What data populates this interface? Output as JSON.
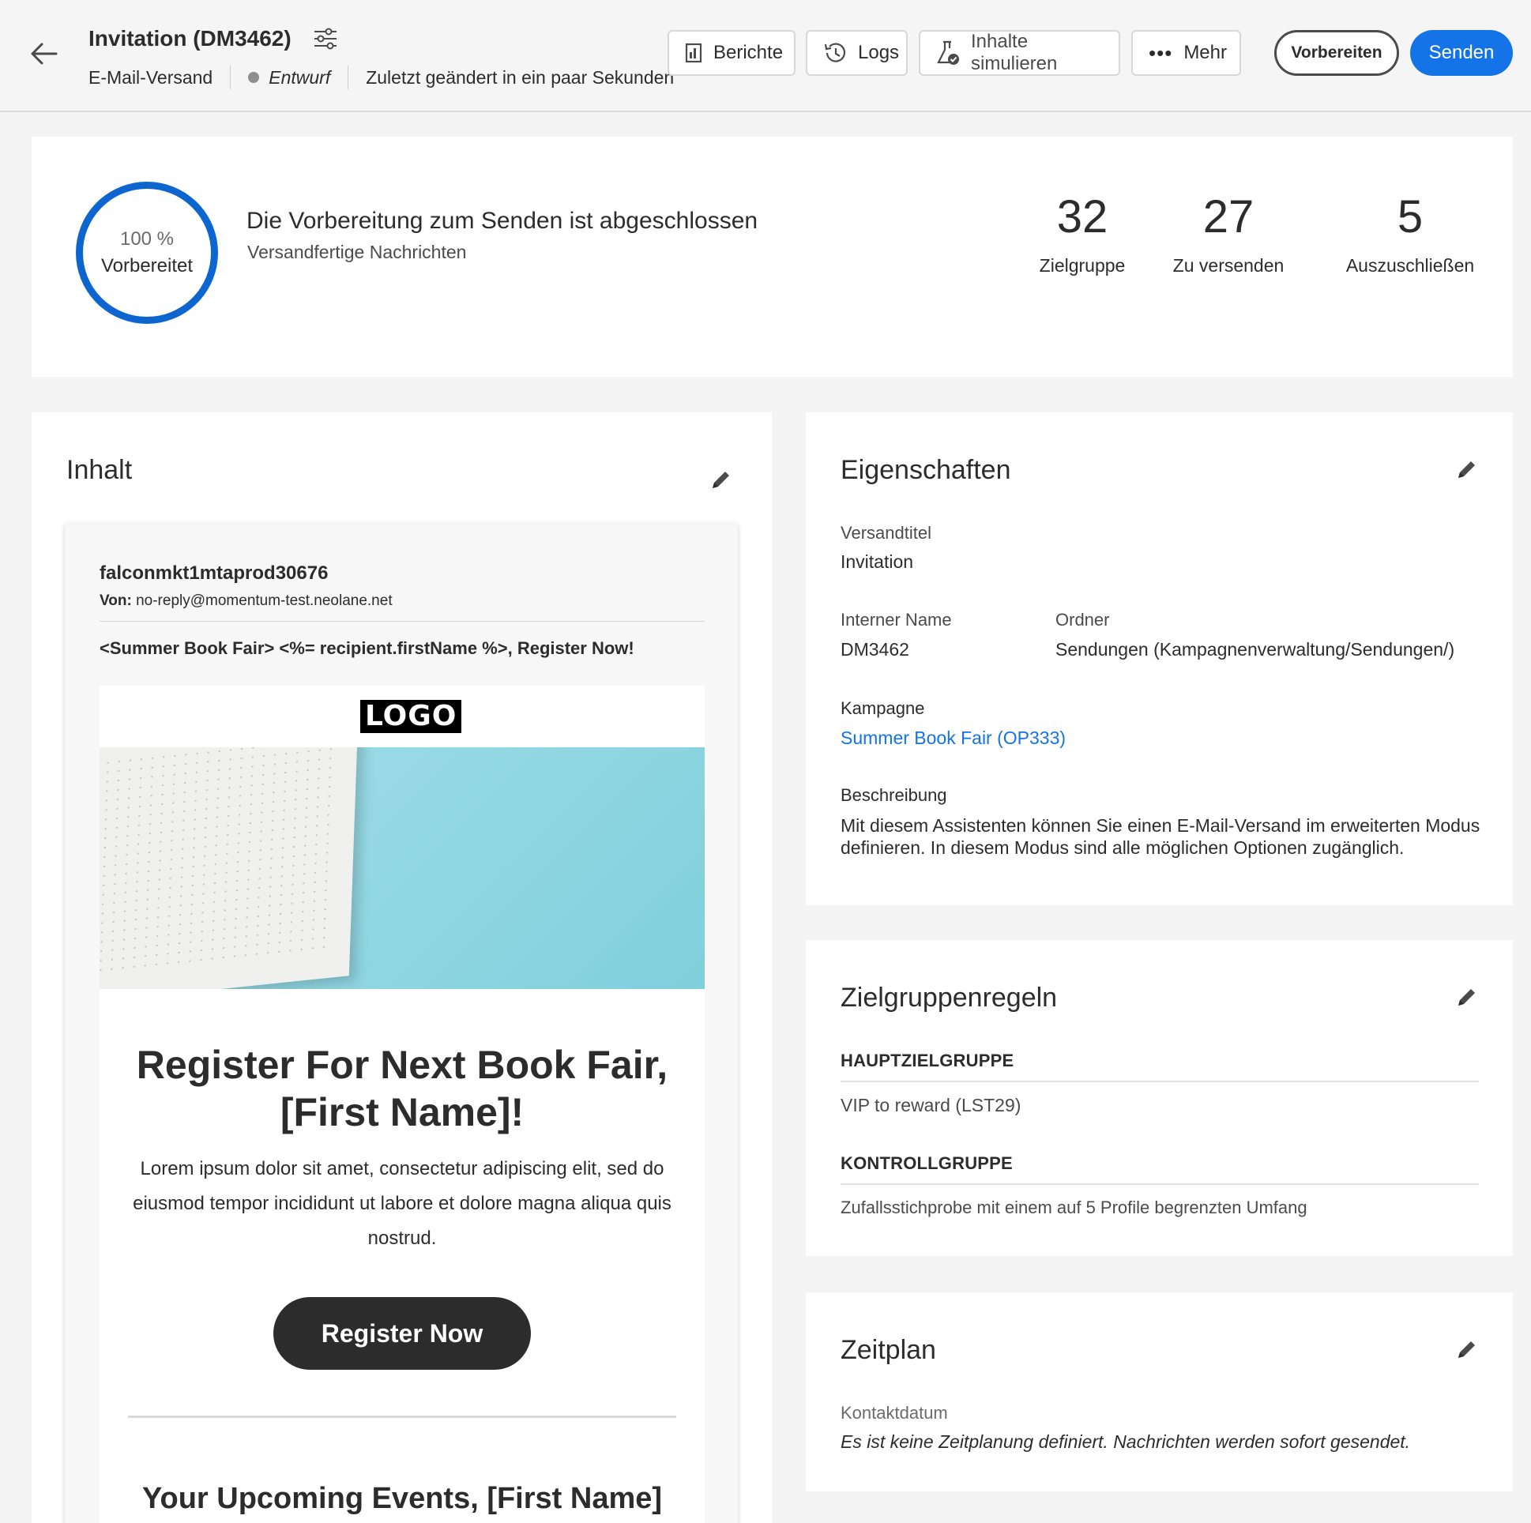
{
  "header": {
    "title": "Invitation (DM3462)",
    "type": "E-Mail-Versand",
    "status": "Entwurf",
    "modified": "Zuletzt geändert in ein paar Sekunden",
    "buttons": {
      "reports": "Berichte",
      "logs": "Logs",
      "simulate": "Inhalte simulieren",
      "more": "Mehr",
      "prepare": "Vorbereiten",
      "send": "Senden"
    }
  },
  "summary": {
    "progress_percent": 100,
    "progress_text": "100 %",
    "progress_label": "Vorbereitet",
    "title": "Die Vorbereitung zum Senden ist abgeschlossen",
    "subtitle": "Versandfertige Nachrichten",
    "stats": [
      {
        "value": "32",
        "label": "Zielgruppe"
      },
      {
        "value": "27",
        "label": "Zu versenden"
      },
      {
        "value": "5",
        "label": "Auszuschließen"
      }
    ]
  },
  "content": {
    "title": "Inhalt",
    "sender": "falconmkt1mtaprod30676",
    "from_label": "Von:",
    "from_value": "no-reply@momentum-test.neolane.net",
    "subject": "<Summer Book Fair> <%= recipient.firstName %>, Register Now!",
    "logo": "LOGO",
    "headline": "Register For Next Book Fair, [First Name]!",
    "body": "Lorem ipsum dolor sit amet, consectetur adipiscing elit, sed do eiusmod tempor incididunt ut labore et dolore magna aliqua quis nostrud.",
    "cta": "Register Now",
    "events_heading": "Your Upcoming Events, [First Name]"
  },
  "properties": {
    "title": "Eigenschaften",
    "delivery_title_label": "Versandtitel",
    "delivery_title_value": "Invitation",
    "internal_name_label": "Interner Name",
    "internal_name_value": "DM3462",
    "folder_label": "Ordner",
    "folder_value": "Sendungen (Kampagnenverwaltung/Sendungen/)",
    "campaign_label": "Kampagne",
    "campaign_value": "Summer Book Fair (OP333)",
    "description_label": "Beschreibung",
    "description_value": "Mit diesem Assistenten können Sie einen E-Mail-Versand im erweiterten Modus definieren. In diesem Modus sind alle möglichen Optionen zugänglich."
  },
  "audience_rules": {
    "title": "Zielgruppenregeln",
    "main_heading": "HAUPTZIELGRUPPE",
    "main_value": "VIP to reward (LST29)",
    "control_heading": "KONTROLLGRUPPE",
    "control_value": "Zufallsstichprobe mit einem auf 5 Profile begrenzten Umfang"
  },
  "schedule": {
    "title": "Zeitplan",
    "contact_date_label": "Kontaktdatum",
    "contact_date_value": "Es ist keine Zeitplanung definiert. Nachrichten werden sofort gesendet."
  },
  "colors": {
    "accent": "#1473e6",
    "ring": "#0d66d0",
    "status_dot": "#8e8e8e"
  }
}
